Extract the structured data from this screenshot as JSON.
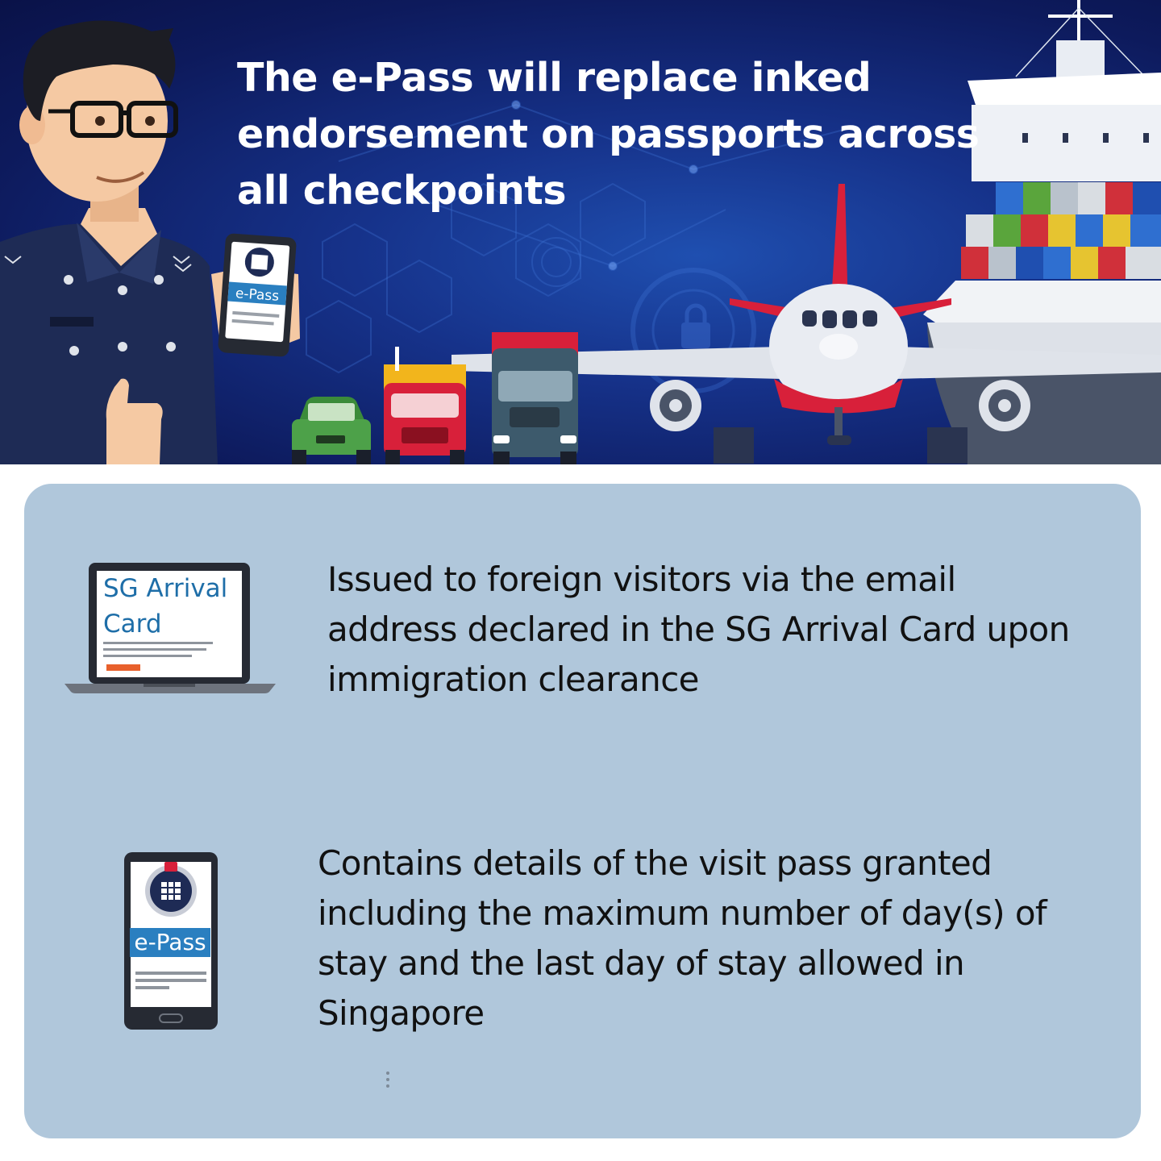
{
  "banner": {
    "headline_lines": [
      "The e-Pass will  replace inked",
      "endorsement on passports across",
      "all checkpoints"
    ],
    "hand_phone_label": "e-Pass"
  },
  "items": [
    {
      "icon": "laptop-icon",
      "icon_title_lines": [
        "SG Arrival",
        "Card"
      ],
      "text_lines": [
        "Issued to foreign visitors via the email",
        "address declared in the SG Arrival Card upon",
        "immigration clearance"
      ]
    },
    {
      "icon": "phone-epass-icon",
      "icon_label": "e-Pass",
      "text_lines": [
        "Contains details of the visit pass granted",
        "including the maximum number of day(s) of",
        "stay and the last day of stay allowed in",
        "Singapore"
      ]
    }
  ],
  "colors": {
    "banner_dark": "#0a1248",
    "banner_light": "#1f4fb0",
    "panel": "#b0c7db",
    "epass_blue": "#2a7fc0",
    "laptop_title": "#1e6ea8"
  }
}
